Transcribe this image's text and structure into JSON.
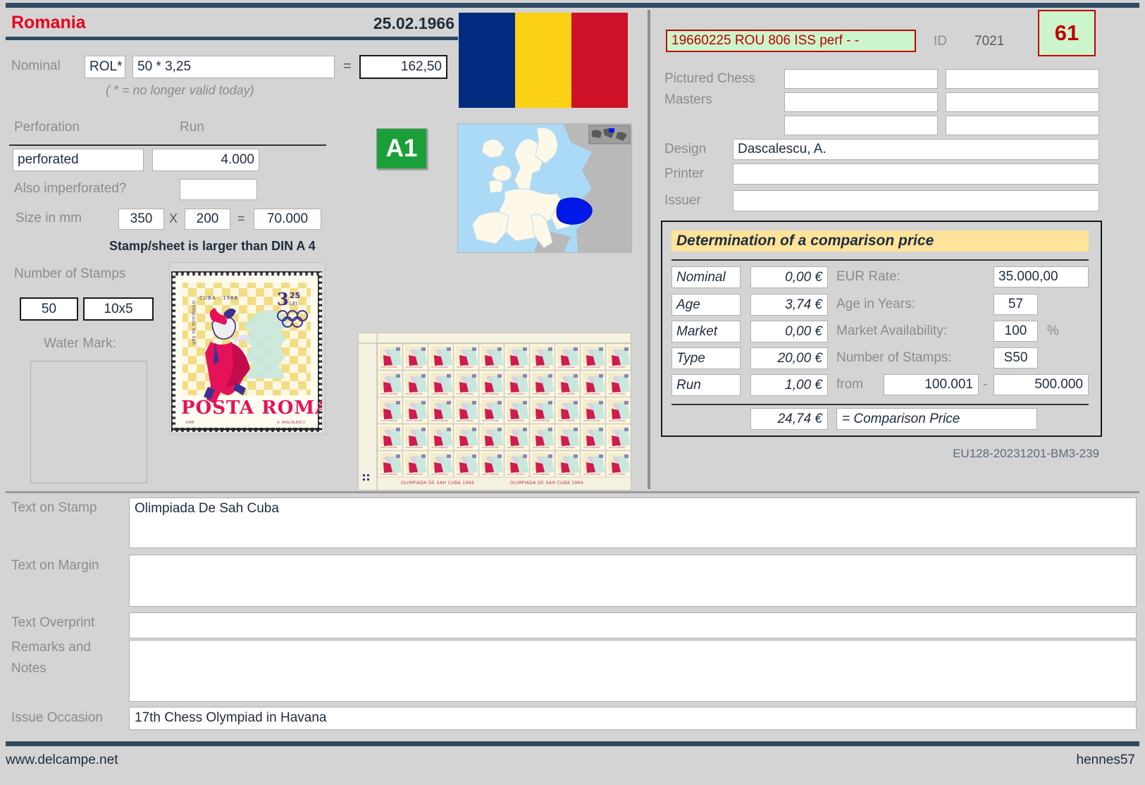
{
  "header": {
    "country": "Romania",
    "date": "25.02.1966"
  },
  "nominal": {
    "label": "Nominal",
    "currency": "ROL*",
    "expression": "50 * 3,25",
    "equals": "=",
    "total": "162,50",
    "note": "( * = no longer valid today)"
  },
  "perforation": {
    "perforation_label": "Perforation",
    "run_label": "Run",
    "perforation_value": "perforated",
    "run_value": "4.000",
    "also_imperforated_label": "Also imperforated?",
    "also_imperforated_value": "",
    "size_label": "Size in mm",
    "size_width": "350",
    "size_x": "X",
    "size_height": "200",
    "size_equals": "=",
    "size_total": "70.000",
    "size_note": "Stamp/sheet is larger than DIN A 4"
  },
  "stamps": {
    "number_label": "Number of Stamps",
    "count": "50",
    "grid": "10x5",
    "watermark_label": "Water Mark:",
    "watermark_value": ""
  },
  "grade": {
    "badge": "A1",
    "badge_color": "#1ba039"
  },
  "flag": {
    "colors": [
      "#002b7f",
      "#fcd116",
      "#ce1126"
    ]
  },
  "right": {
    "reference_code": "19660225 ROU 806 ISS perf - -",
    "id_label": "ID",
    "id_value": "7021",
    "count_badge": "61",
    "pictured_label_line1": "Pictured Chess",
    "pictured_label_line2": "Masters",
    "pictured_values": [
      "",
      "",
      "",
      "",
      "",
      ""
    ],
    "design_label": "Design",
    "design_value": "Dascalescu, A.",
    "printer_label": "Printer",
    "printer_value": "",
    "issuer_label": "Issuer",
    "issuer_value": ""
  },
  "comparison": {
    "title": "Determination of a comparison price",
    "rows": [
      {
        "name": "Nominal",
        "value": "0,00 €",
        "desc": "EUR Rate:",
        "input": "35.000,00"
      },
      {
        "name": "Age",
        "value": "3,74 €",
        "desc": "Age in Years:",
        "input": "57"
      },
      {
        "name": "Market",
        "value": "0,00 €",
        "desc": "Market Availability:",
        "input": "100"
      },
      {
        "name": "Type",
        "value": "20,00 €",
        "desc": "Number of Stamps:",
        "input": "S50"
      },
      {
        "name": "Run",
        "value": "1,00 €",
        "desc": "from",
        "input": "100.001"
      }
    ],
    "percent_sign": "%",
    "range_dash": "-",
    "range_to": "500.000",
    "result_value": "24,74 €",
    "result_label": "= Comparison Price",
    "archive_code": "EU128-20231201-BM3-239"
  },
  "bottom": {
    "text_on_stamp_label": "Text on Stamp",
    "text_on_stamp_value": "Olimpiada De Sah Cuba",
    "text_on_margin_label": "Text on Margin",
    "text_on_margin_value": "",
    "text_overprint_label": "Text Overprint",
    "text_overprint_value": "",
    "remarks_label_line1": "Remarks and",
    "remarks_label_line2": "Notes",
    "remarks_value": "",
    "issue_occasion_label": "Issue Occasion",
    "issue_occasion_value": "17th Chess Olympiad in Havana"
  },
  "footer": {
    "left": "www.delcampe.net",
    "right": "hennes57"
  }
}
